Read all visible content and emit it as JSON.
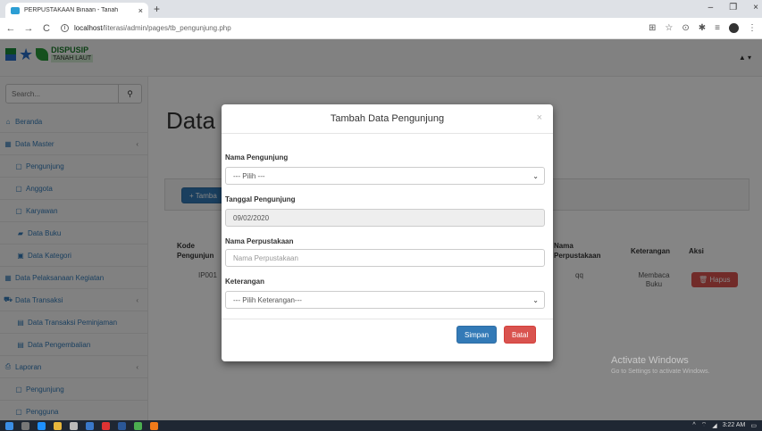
{
  "browser": {
    "tab_title": "PERPUSTAKAAN Binaan - Tanah",
    "tab_close": "×",
    "new_tab": "+",
    "window_controls": [
      "–",
      "❐",
      "×"
    ],
    "url_host": "localhost",
    "url_path": "/literasi/admin/pages/tb_pengunjung.php"
  },
  "app": {
    "logo_line1": "DISPUSIP",
    "logo_line2": "TANAH LAUT",
    "user_menu": "▲ ▾"
  },
  "sidebar": {
    "search_placeholder": "Search...",
    "items": [
      {
        "label": "Beranda",
        "icon": "home-icon",
        "glyph": "⌂"
      },
      {
        "label": "Data Master",
        "icon": "grid-icon",
        "glyph": "▦",
        "chevron": "‹"
      },
      {
        "label": "Pengunjung",
        "icon": "document-icon",
        "glyph": "▢"
      },
      {
        "label": "Anggota",
        "icon": "document-icon",
        "glyph": "▢"
      },
      {
        "label": "Karyawan",
        "icon": "document-icon",
        "glyph": "▢"
      },
      {
        "label": "Data Buku",
        "icon": "book-icon",
        "glyph": "▰"
      },
      {
        "label": "Data Kategori",
        "icon": "image-icon",
        "glyph": "▣"
      },
      {
        "label": "Data Pelaksanaan Kegiatan",
        "icon": "grid-icon",
        "glyph": "▦"
      },
      {
        "label": "Data Transaksi",
        "icon": "cart-icon",
        "glyph": "⛟",
        "chevron": "‹"
      },
      {
        "label": "Data Transaksi Peminjaman",
        "icon": "table-icon",
        "glyph": "▤"
      },
      {
        "label": "Data Pengembalian",
        "icon": "table-icon",
        "glyph": "▤"
      },
      {
        "label": "Laporan",
        "icon": "print-icon",
        "glyph": "⎙",
        "chevron": "‹"
      },
      {
        "label": "Pengunjung",
        "icon": "document-icon",
        "glyph": "▢"
      },
      {
        "label": "Pengguna",
        "icon": "document-icon",
        "glyph": "▢"
      }
    ]
  },
  "content": {
    "title": "Data P",
    "add_button": "+ Tamba",
    "table": {
      "headers": {
        "kode": "Kode Pengunjun",
        "nama_perpustakaan": "Nama Perpustakaan",
        "keterangan": "Keterangan",
        "aksi": "Aksi"
      },
      "row": {
        "kode": "IP001",
        "nama_perpustakaan": "qq",
        "keterangan": "Membaca Buku",
        "aksi": "Hapus"
      }
    }
  },
  "modal": {
    "title": "Tambah Data Pengunjung",
    "close": "×",
    "nama_pengunjung_label": "Nama Pengunjung",
    "nama_pengunjung_value": "--- Pilih ---",
    "tanggal_label": "Tanggal Pengunjung",
    "tanggal_value": "09/02/2020",
    "nama_perpustakaan_label": "Nama Perpustakaan",
    "nama_perpustakaan_placeholder": "Nama Perpustakaan",
    "keterangan_label": "Keterangan",
    "keterangan_value": "--- Pilih Keterangan---",
    "simpan": "Simpan",
    "batal": "Batal"
  },
  "watermark": {
    "line1": "Activate Windows",
    "line2": "Go to Settings to activate Windows."
  },
  "taskbar": {
    "time": "3:22 AM"
  },
  "colors": {
    "primary": "#337ab7",
    "danger": "#d9534f",
    "backdrop": "rgba(0,0,0,0.48)"
  }
}
